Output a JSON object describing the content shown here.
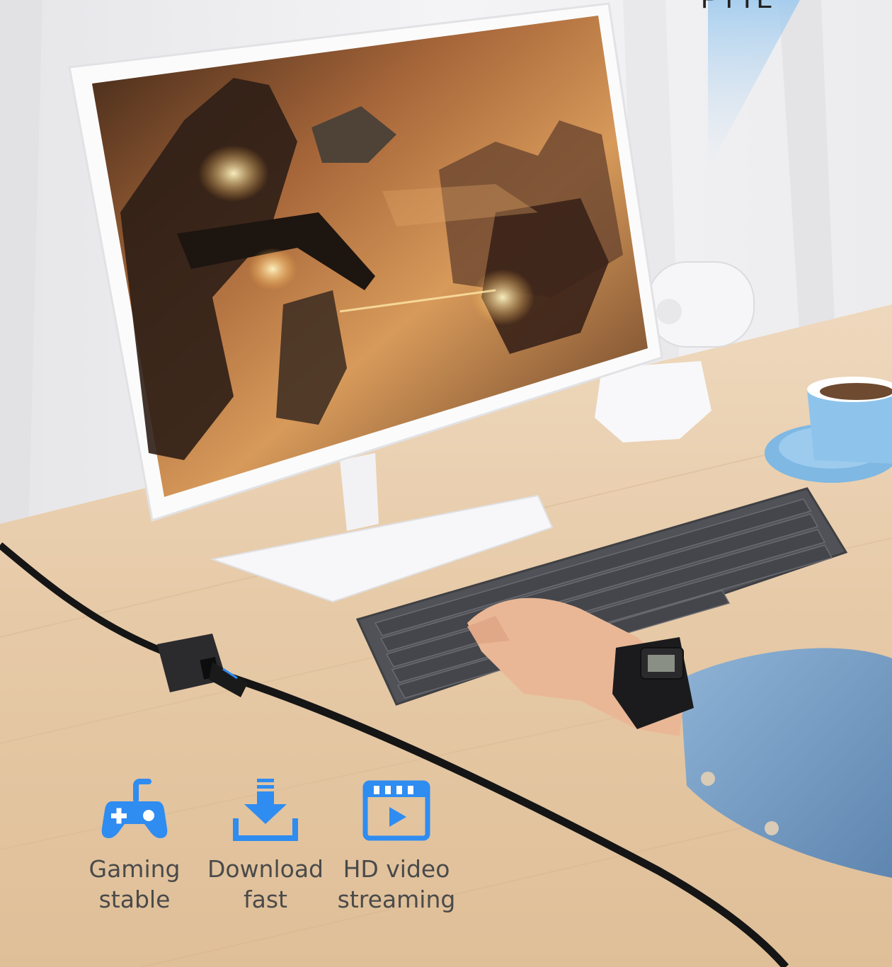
{
  "corner_text": "PTTL",
  "features": [
    {
      "icon": "gamepad-icon",
      "label": "Gaming\nstable"
    },
    {
      "icon": "download-icon",
      "label": "Download\nfast"
    },
    {
      "icon": "video-play-icon",
      "label": "HD video\nstreaming"
    }
  ],
  "colors": {
    "icon_blue": "#2f8cf0",
    "icon_blue_light": "#4aa8f7",
    "label_gray": "#4a4a4a",
    "desk_wood": "#e8cfb0",
    "wall": "#f1f1f3"
  }
}
